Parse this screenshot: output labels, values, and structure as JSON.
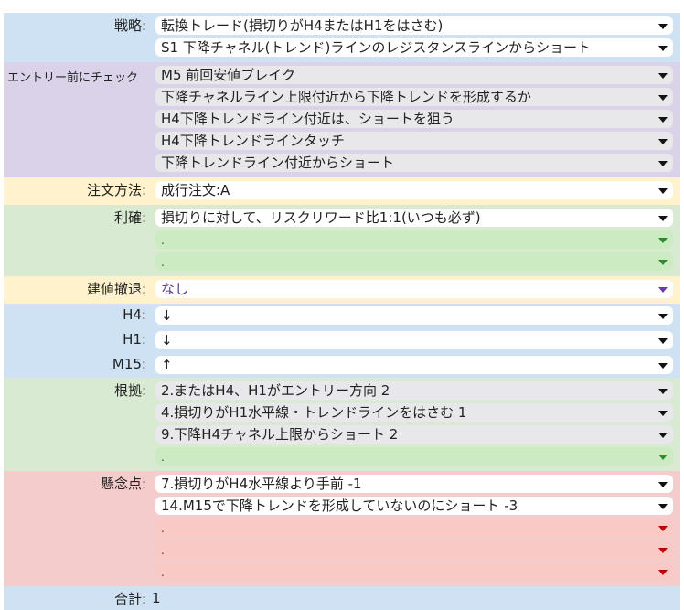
{
  "strategy": {
    "label": "戦略:",
    "values": [
      "転換トレード(損切りがH4またはH1をはさむ)",
      "S1 下降チャネル(トレンド)ラインのレジスタンスラインからショート"
    ]
  },
  "entry_check": {
    "label": "エントリー前にチェック",
    "values": [
      "M5 前回安値ブレイク",
      "下降チャネルライン上限付近から下降トレンドを形成するか",
      "H4下降トレンドライン付近は、ショートを狙う",
      "H4下降トレンドラインタッチ",
      "下降トレンドライン付近からショート"
    ]
  },
  "order_method": {
    "label": "注文方法:",
    "value": "成行注文:A"
  },
  "take_profit": {
    "label": "利確:",
    "values": [
      "損切りに対して、リスクリワード比1:1(いつも必ず)",
      ".",
      "."
    ]
  },
  "cancel": {
    "label": "建値撤退:",
    "value": "なし"
  },
  "timeframes": {
    "h4": {
      "label": "H4:",
      "value": "↓"
    },
    "h1": {
      "label": "H1:",
      "value": "↓"
    },
    "m15": {
      "label": "M15:",
      "value": "↑"
    }
  },
  "reasons": {
    "label": "根拠:",
    "values": [
      "2.またはH4、H1がエントリー方向 2",
      "4.損切りがH1水平線・トレンドラインをはさむ 1",
      "9.下降H4チャネル上限からショート 2",
      "."
    ]
  },
  "concerns": {
    "label": "懸念点:",
    "values": [
      "7.損切りがH4水平線より手前 -1",
      "14.M15で下降トレンドを形成していないのにショート -3",
      ".",
      ".",
      "."
    ]
  },
  "total": {
    "label": "合計:",
    "value": "1"
  },
  "colors": {
    "blue": "#cfe2f3",
    "purple": "#d9d2e9",
    "yellow": "#fff2cc",
    "green": "#d9ead3",
    "red": "#f4cccc"
  }
}
